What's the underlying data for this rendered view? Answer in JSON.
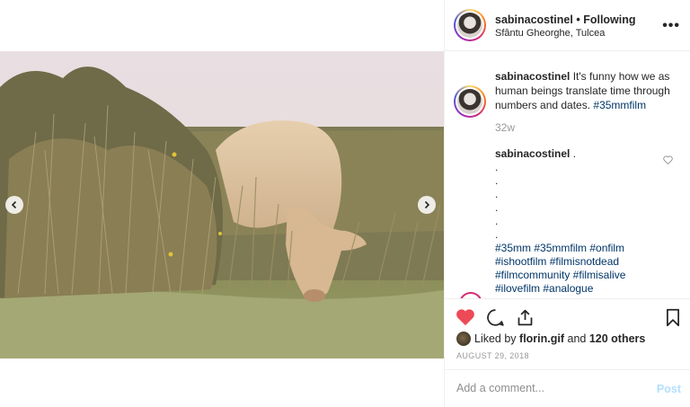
{
  "post": {
    "image_alt": "photo-cow-grazing-grass",
    "prev_icon": "chevron-left-icon",
    "next_icon": "chevron-right-icon"
  },
  "header": {
    "username": "sabinacostinel",
    "separator": "•",
    "follow_status": "Following",
    "location": "Sfântu Gheorghe, Tulcea",
    "more_icon": "more-options-icon",
    "more_label": "•••"
  },
  "caption": {
    "username": "sabinacostinel",
    "text": " It's funny how we as human beings translate time through numbers and dates. ",
    "hashtag": "#35mmfilm",
    "age": "32w"
  },
  "comment": {
    "username": "sabinacostinel",
    "first_line": " .",
    "dots": [
      ".",
      ".",
      ".",
      ".",
      ".",
      "."
    ],
    "hashtags": "#35mm #35mmfilm #onfilm #ishootfilm #filmisnotdead #filmcommunity #filmisalive #ilovefilm #analogue",
    "like_icon": "heart-outline-icon"
  },
  "actions": {
    "like_icon": "heart-filled-icon",
    "comment_icon": "comment-icon",
    "share_icon": "share-icon",
    "save_icon": "bookmark-icon",
    "like_color": "#ed4956"
  },
  "likes": {
    "prefix": "Liked by ",
    "user": "florin.gif",
    "middle": " and ",
    "others": "120 others"
  },
  "date": "AUGUST 29, 2018",
  "composer": {
    "placeholder": "Add a comment...",
    "post_label": "Post",
    "post_color": "#b2dffc"
  }
}
